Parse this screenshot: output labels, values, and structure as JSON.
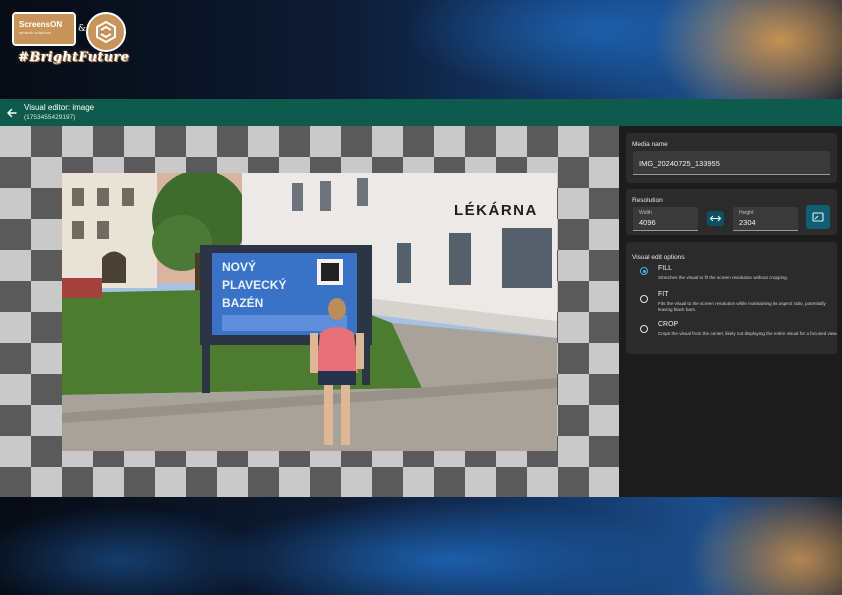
{
  "branding": {
    "logo_name": "ScreensON",
    "logo_subtitle": "network solutions",
    "ampersand": "&",
    "hashtag": "#BrightFuture"
  },
  "header": {
    "title": "Visual editor: image",
    "subtitle": "(1753455429197)",
    "back_icon": "arrow-left-icon"
  },
  "colors": {
    "header_bg": "#0e5a4b",
    "accent": "#3fb6de",
    "panel_bg": "#1c1c1c"
  },
  "photo": {
    "sign_text": [
      "NOVÝ",
      "PLAVECKÝ",
      "BAZÉN"
    ],
    "building_text": "LÉKÁRNA"
  },
  "media_name": {
    "label": "Media name",
    "value": "IMG_20240725_133955"
  },
  "resolution": {
    "title": "Resolution",
    "width_label": "Width",
    "width_value": "4096",
    "height_label": "Height",
    "height_value": "2304",
    "swap_icon": "swap-horizontal-icon",
    "fit_icon": "aspect-ratio-icon"
  },
  "visual_edit": {
    "title": "Visual edit options",
    "options": [
      {
        "name": "FILL",
        "desc": "Stretches the visual to fit the screen resolution without cropping.",
        "selected": true
      },
      {
        "name": "FIT",
        "desc": "Fits the visual to the screen resolution while maintaining its aspect ratio, potentially leaving black bars.",
        "selected": false
      },
      {
        "name": "CROP",
        "desc": "Crops the visual from the center, likely not displaying the entire visual for a focused view.",
        "selected": false
      }
    ]
  }
}
